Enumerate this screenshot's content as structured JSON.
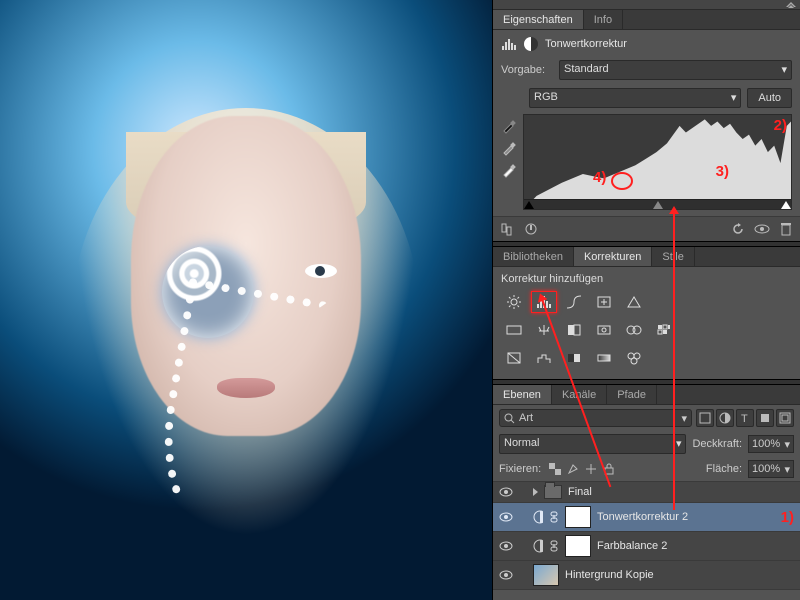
{
  "tabs_properties": {
    "active": "Eigenschaften",
    "inactive": "Info"
  },
  "adjustment": {
    "name": "Tonwertkorrektur",
    "preset_label": "Vorgabe:",
    "preset_value": "Standard",
    "channel_value": "RGB",
    "auto_label": "Auto"
  },
  "annotations": {
    "a1": "1)",
    "a2": "2)",
    "a3": "3)",
    "a4": "4)"
  },
  "tabs_lib": {
    "t1": "Bibliotheken",
    "t2": "Korrekturen",
    "t3": "Stile"
  },
  "corrections_add_label": "Korrektur hinzufügen",
  "tabs_layers": {
    "t1": "Ebenen",
    "t2": "Kanäle",
    "t3": "Pfade"
  },
  "layers": {
    "filter_kind": "Art",
    "blend_mode": "Normal",
    "opacity_label": "Deckkraft:",
    "opacity_value": "100%",
    "lock_label": "Fixieren:",
    "fill_label": "Fläche:",
    "fill_value": "100%",
    "group_name": "Final",
    "layer1": "Tonwertkorrektur 2",
    "layer2": "Farbbalance 2",
    "layer3": "Hintergrund Kopie"
  }
}
